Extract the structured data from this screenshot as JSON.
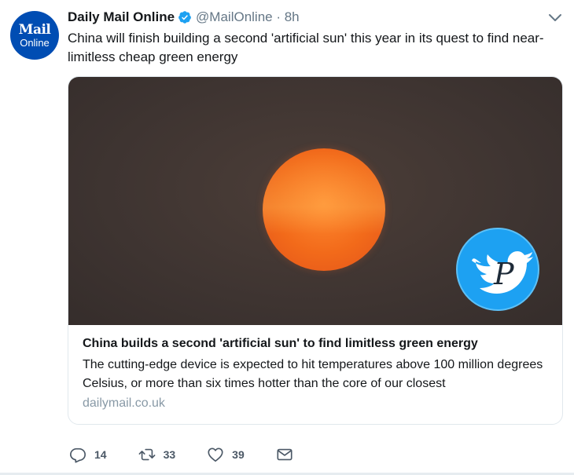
{
  "tweet": {
    "account": {
      "avatar_line1": "Mail",
      "avatar_line2": "Online",
      "name": "Daily Mail Online",
      "handle_time": "@MailOnline · 8h",
      "verified": true
    },
    "text": "China will finish building a second 'artificial sun' this year in its quest to find near-limitless cheap green energy",
    "card": {
      "image_description_icon": "watermark-p-bird-icon",
      "title": "China builds a second 'artificial sun' to find limitless green energy",
      "description": "The cutting-edge device is expected to hit temperatures above 100 million degrees Celsius, or more than six times hotter than the core of our closest",
      "domain": "dailymail.co.uk"
    },
    "actions": {
      "replies": "14",
      "retweets": "33",
      "likes": "39"
    }
  },
  "colors": {
    "brand_blue": "#004db3",
    "twitter_blue": "#1da1f2",
    "text_primary": "#14171a",
    "text_secondary": "#657786"
  },
  "icons": [
    "verified-badge-icon",
    "chevron-down-icon",
    "reply-icon",
    "retweet-icon",
    "like-icon",
    "direct-message-icon"
  ]
}
